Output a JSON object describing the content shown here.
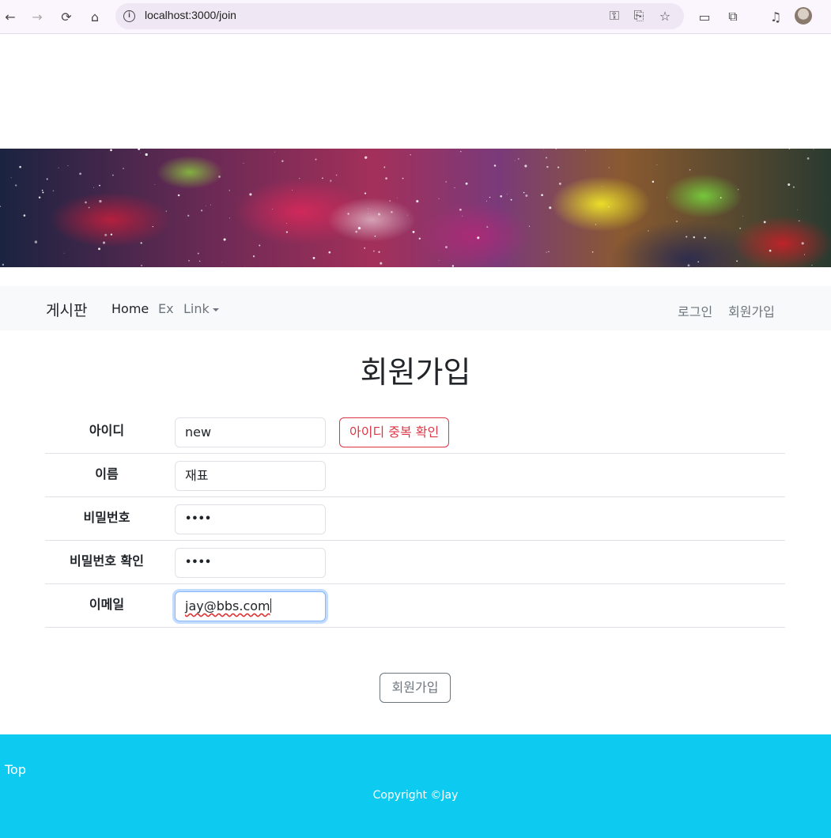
{
  "browser": {
    "url": "localhost:3000/join"
  },
  "navbar": {
    "brand": "게시판",
    "items": [
      "Home",
      "Ex",
      "Link"
    ],
    "right_items": [
      "로그인",
      "회원가입"
    ]
  },
  "main": {
    "title": "회원가입",
    "fields": [
      {
        "label": "아이디",
        "value": "new"
      },
      {
        "label": "이름",
        "value": "재표"
      },
      {
        "label": "비밀번호",
        "value": "••••"
      },
      {
        "label": "비밀번호 확인",
        "value": "••••"
      },
      {
        "label": "이메일",
        "value": "jay@bbs.com"
      }
    ],
    "check_id_button": "아이디 중복 확인",
    "submit_button": "회원가입"
  },
  "footer": {
    "top_link": "Top",
    "copyright": "Copyright ©Jay"
  },
  "colors": {
    "footer_bg": "#0dcaf0",
    "navbar_bg": "#f8f9fa",
    "danger": "#dc3545",
    "secondary": "#6c757d"
  }
}
